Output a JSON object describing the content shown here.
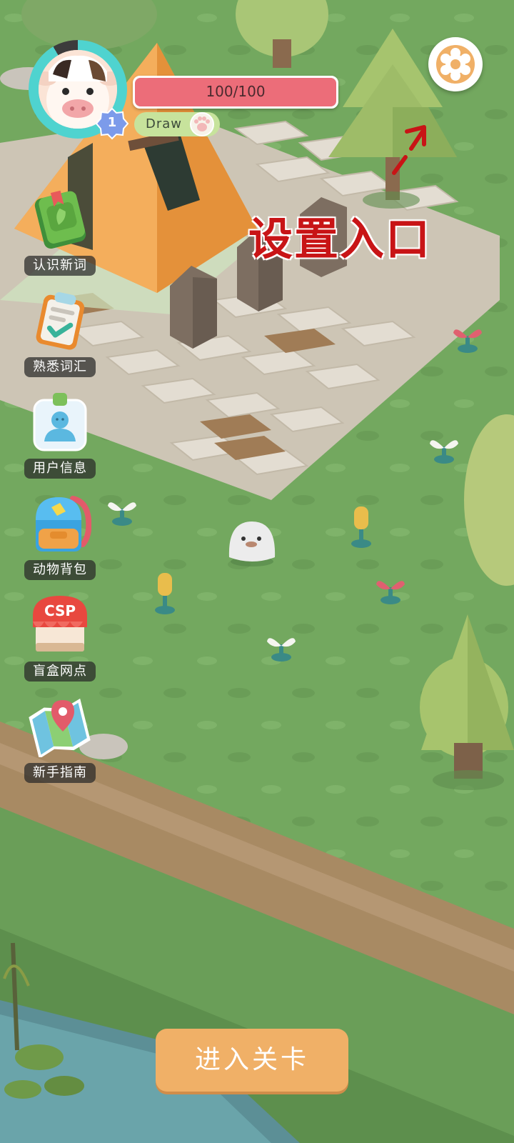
{
  "hud": {
    "player_level": "1",
    "hp_text": "100/100",
    "hp_fraction": 1.0,
    "draw_label": "Draw",
    "avatar_icon": "cow-avatar-icon",
    "settings_icon": "gear-icon"
  },
  "annotation": {
    "settings_hint": "设置入口"
  },
  "menu": {
    "items": [
      {
        "label": "认识新词",
        "icon": "green-book-icon"
      },
      {
        "label": "熟悉词汇",
        "icon": "clipboard-check-icon"
      },
      {
        "label": "用户信息",
        "icon": "user-badge-icon"
      },
      {
        "label": "动物背包",
        "icon": "backpack-icon"
      },
      {
        "label": "盲盒网点",
        "icon": "csp-shop-icon"
      },
      {
        "label": "新手指南",
        "icon": "map-pin-icon"
      }
    ],
    "shop_sign_text": "CSP"
  },
  "footer": {
    "enter_level_label": "进入关卡"
  },
  "colors": {
    "grass": "#6fa35c",
    "path_stone": "#d9d3c7",
    "tent": "#f0a248",
    "hp_fill": "#ec6d79",
    "button": "#f0b067",
    "annotation": "#c81416"
  }
}
